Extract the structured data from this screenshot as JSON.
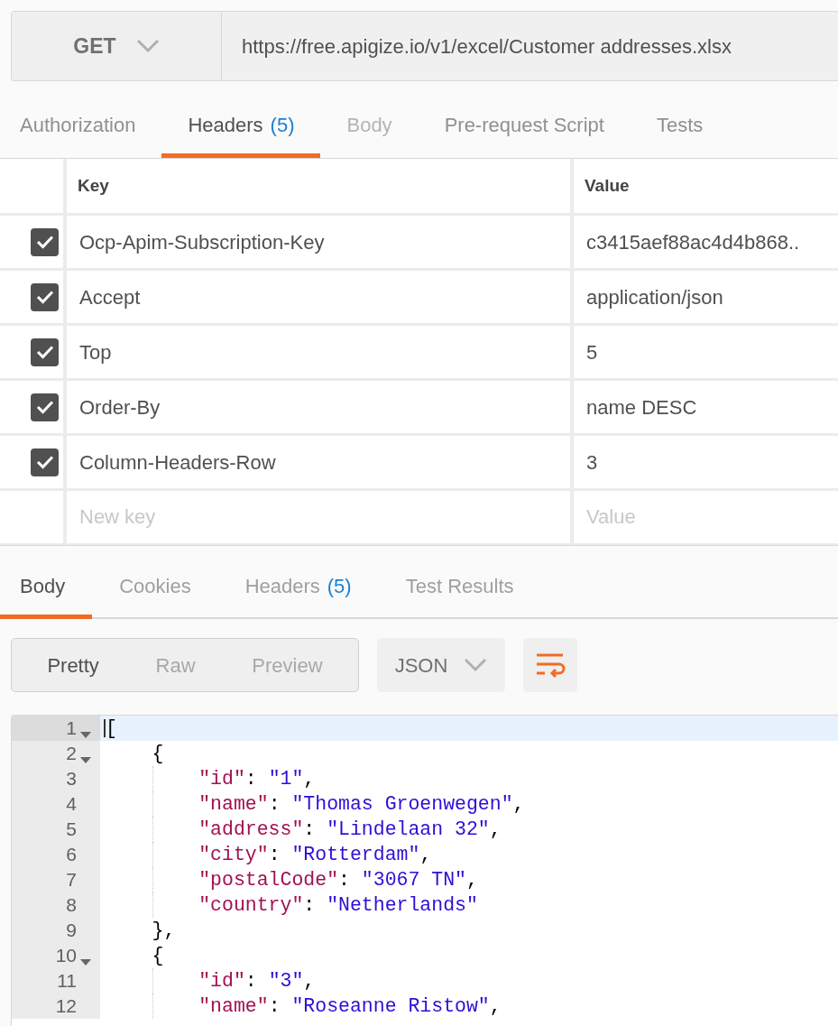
{
  "request": {
    "method": "GET",
    "url": "https://free.apigize.io/v1/excel/Customer addresses.xlsx"
  },
  "request_tabs": [
    {
      "label": "Authorization",
      "selected": false,
      "disabled": false
    },
    {
      "label": "Headers",
      "count": "(5)",
      "selected": true,
      "disabled": false
    },
    {
      "label": "Body",
      "selected": false,
      "disabled": true
    },
    {
      "label": "Pre-request Script",
      "selected": false,
      "disabled": false
    },
    {
      "label": "Tests",
      "selected": false,
      "disabled": false
    }
  ],
  "headers_table": {
    "columns": [
      "Key",
      "Value"
    ],
    "rows": [
      {
        "checked": true,
        "key": "Ocp-Apim-Subscription-Key",
        "value": "c3415aef88ac4d4b868.."
      },
      {
        "checked": true,
        "key": "Accept",
        "value": "application/json"
      },
      {
        "checked": true,
        "key": "Top",
        "value": "5"
      },
      {
        "checked": true,
        "key": "Order-By",
        "value": "name DESC"
      },
      {
        "checked": true,
        "key": "Column-Headers-Row",
        "value": "3"
      }
    ],
    "new_row": {
      "key_placeholder": "New key",
      "value_placeholder": "Value"
    }
  },
  "response_tabs": [
    {
      "label": "Body",
      "selected": true
    },
    {
      "label": "Cookies",
      "selected": false
    },
    {
      "label": "Headers",
      "count": "(5)",
      "selected": false
    },
    {
      "label": "Test Results",
      "selected": false
    }
  ],
  "view_modes": [
    {
      "label": "Pretty",
      "selected": true
    },
    {
      "label": "Raw",
      "selected": false
    },
    {
      "label": "Preview",
      "selected": false
    }
  ],
  "format": "JSON",
  "code_lines": [
    {
      "number": "1",
      "foldable": true,
      "active": true,
      "tokens": [
        {
          "kind": "punct",
          "text": "["
        }
      ]
    },
    {
      "number": "2",
      "foldable": true,
      "active": false,
      "tokens": [
        {
          "kind": "punct",
          "text": "    {"
        }
      ]
    },
    {
      "number": "3",
      "foldable": false,
      "active": false,
      "tokens": [
        {
          "kind": "key",
          "text": "        \"id\""
        },
        {
          "kind": "punct",
          "text": ": "
        },
        {
          "kind": "string",
          "text": "\"1\""
        },
        {
          "kind": "punct",
          "text": ","
        }
      ]
    },
    {
      "number": "4",
      "foldable": false,
      "active": false,
      "tokens": [
        {
          "kind": "key",
          "text": "        \"name\""
        },
        {
          "kind": "punct",
          "text": ": "
        },
        {
          "kind": "string",
          "text": "\"Thomas Groenwegen\""
        },
        {
          "kind": "punct",
          "text": ","
        }
      ]
    },
    {
      "number": "5",
      "foldable": false,
      "active": false,
      "tokens": [
        {
          "kind": "key",
          "text": "        \"address\""
        },
        {
          "kind": "punct",
          "text": ": "
        },
        {
          "kind": "string",
          "text": "\"Lindelaan 32\""
        },
        {
          "kind": "punct",
          "text": ","
        }
      ]
    },
    {
      "number": "6",
      "foldable": false,
      "active": false,
      "tokens": [
        {
          "kind": "key",
          "text": "        \"city\""
        },
        {
          "kind": "punct",
          "text": ": "
        },
        {
          "kind": "string",
          "text": "\"Rotterdam\""
        },
        {
          "kind": "punct",
          "text": ","
        }
      ]
    },
    {
      "number": "7",
      "foldable": false,
      "active": false,
      "tokens": [
        {
          "kind": "key",
          "text": "        \"postalCode\""
        },
        {
          "kind": "punct",
          "text": ": "
        },
        {
          "kind": "string",
          "text": "\"3067 TN\""
        },
        {
          "kind": "punct",
          "text": ","
        }
      ]
    },
    {
      "number": "8",
      "foldable": false,
      "active": false,
      "tokens": [
        {
          "kind": "key",
          "text": "        \"country\""
        },
        {
          "kind": "punct",
          "text": ": "
        },
        {
          "kind": "string",
          "text": "\"Netherlands\""
        }
      ]
    },
    {
      "number": "9",
      "foldable": false,
      "active": false,
      "tokens": [
        {
          "kind": "punct",
          "text": "    },"
        }
      ]
    },
    {
      "number": "10",
      "foldable": true,
      "active": false,
      "tokens": [
        {
          "kind": "punct",
          "text": "    {"
        }
      ]
    },
    {
      "number": "11",
      "foldable": false,
      "active": false,
      "tokens": [
        {
          "kind": "key",
          "text": "        \"id\""
        },
        {
          "kind": "punct",
          "text": ": "
        },
        {
          "kind": "string",
          "text": "\"3\""
        },
        {
          "kind": "punct",
          "text": ","
        }
      ]
    },
    {
      "number": "12",
      "foldable": false,
      "active": false,
      "tokens": [
        {
          "kind": "key",
          "text": "        \"name\""
        },
        {
          "kind": "punct",
          "text": ": "
        },
        {
          "kind": "string",
          "text": "\"Roseanne Ristow\""
        },
        {
          "kind": "punct",
          "text": ","
        }
      ]
    }
  ]
}
